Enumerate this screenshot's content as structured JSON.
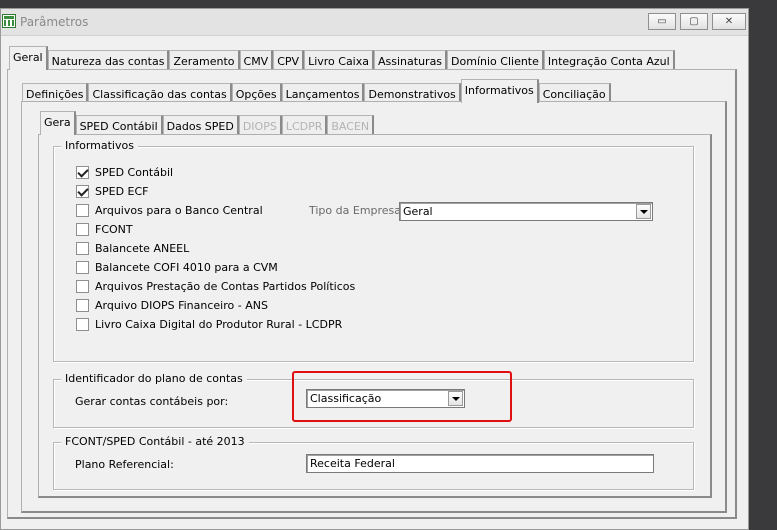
{
  "window": {
    "title": "Parâmetros",
    "controls": {
      "minimize": "▭",
      "restore": "▢",
      "close": "✕"
    }
  },
  "tabs_main": [
    "Geral",
    "Natureza das contas",
    "Zeramento",
    "CMV",
    "CPV",
    "Livro Caixa",
    "Assinaturas",
    "Domínio Cliente",
    "Integração Conta Azul"
  ],
  "tabs_sub": [
    "Definições",
    "Classificação das contas",
    "Opções",
    "Lançamentos",
    "Demonstrativos",
    "Informativos",
    "Conciliação"
  ],
  "tabs_inner": [
    {
      "label": "Gera",
      "disabled": false
    },
    {
      "label": "SPED Contábil",
      "disabled": false
    },
    {
      "label": "Dados SPED",
      "disabled": false
    },
    {
      "label": "DIOPS",
      "disabled": true
    },
    {
      "label": "LCDPR",
      "disabled": true
    },
    {
      "label": "BACEN",
      "disabled": true
    }
  ],
  "informativos": {
    "legend": "Informativos",
    "items": [
      {
        "label": "SPED Contábil",
        "checked": true
      },
      {
        "label": "SPED ECF",
        "checked": true
      },
      {
        "label": "Arquivos para o Banco Central",
        "checked": false
      },
      {
        "label": "FCONT",
        "checked": false
      },
      {
        "label": "Balancete ANEEL",
        "checked": false
      },
      {
        "label": "Balancete COFI 4010 para a CVM",
        "checked": false
      },
      {
        "label": "Arquivos Prestação de Contas Partidos Políticos",
        "checked": false
      },
      {
        "label": "Arquivo DIOPS Financeiro - ANS",
        "checked": false
      },
      {
        "label": "Livro Caixa Digital do Produtor Rural - LCDPR",
        "checked": false
      }
    ],
    "tipo_empresa_label": "Tipo da Empresa:",
    "tipo_empresa_value": "Geral"
  },
  "identificador": {
    "legend": "Identificador do plano de contas",
    "label": "Gerar contas contábeis por:",
    "value": "Classificação"
  },
  "fcont": {
    "legend": "FCONT/SPED Contábil - até 2013",
    "label": "Plano Referencial:",
    "value": "Receita Federal"
  },
  "highlight_color": "#e01010"
}
